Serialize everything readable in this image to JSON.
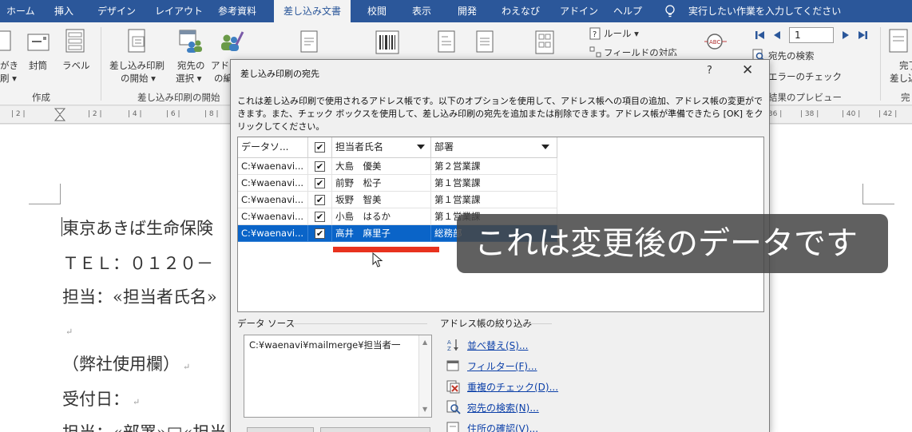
{
  "ribbon_tabs": [
    "ホーム",
    "挿入",
    "デザイン",
    "レイアウト",
    "参考資料",
    "差し込み文書",
    "校閲",
    "表示",
    "開発",
    "わえなび",
    "アドイン",
    "ヘルプ"
  ],
  "active_tab_index": 5,
  "tell_me": "実行したい作業を入力してください",
  "ribbon": {
    "create_group": {
      "hagaki": [
        "がき",
        "刷 ▾"
      ],
      "envelope": "封筒",
      "label": "ラベル",
      "group_label": "作成"
    },
    "start_group": {
      "start_merge": [
        "差し込み印刷",
        "の開始 ▾"
      ],
      "select_recipients": [
        "宛先の",
        "選択 ▾"
      ],
      "edit_list": [
        "アドレ",
        "の編"
      ],
      "group_label": "差し込み印刷の開始"
    },
    "rules": "ルール ▾",
    "match_fields": "フィールドの対応",
    "record_number": "1",
    "find_recipient": "宛先の検索",
    "check_errors": "エラーのチェック",
    "preview_label": "結果のプレビュー",
    "finish": [
      "完了",
      "差し込"
    ],
    "finish_group": "完"
  },
  "ruler_ticks": [
    "| 2 |",
    "| 2 |",
    "| 4 |",
    "| 6 |",
    "| 8 |",
    "| 36 |",
    "| 38 |",
    "| 40 |",
    "| 42 |"
  ],
  "document": {
    "lines": [
      "東京あきば生命保険",
      "ＴＥＬ：０１２０－",
      "担当：«担当者氏名»",
      "",
      "（弊社使用欄）",
      "受付日：",
      "担当：«部署»□«担当"
    ]
  },
  "dialog": {
    "title": "差し込み印刷の宛先",
    "help": "?",
    "close": "✕",
    "description": "これは差し込み印刷で使用されるアドレス帳です。以下のオプションを使用して、アドレス帳への項目の追加、アドレス帳の変更ができます。また、チェック ボックスを使用して、差し込み印刷の宛先を追加または削除できます。アドレス帳が準備できたら [OK] をクリックしてください。",
    "columns": [
      "データソ...",
      "",
      "担当者氏名",
      "部署"
    ],
    "rows": [
      {
        "source": "C:¥waenavi...",
        "checked": "✔",
        "name": "大島　優美",
        "dept": "第２営業課"
      },
      {
        "source": "C:¥waenavi...",
        "checked": "✔",
        "name": "前野　松子",
        "dept": "第１営業課"
      },
      {
        "source": "C:¥waenavi...",
        "checked": "✔",
        "name": "坂野　智美",
        "dept": "第１営業課"
      },
      {
        "source": "C:¥waenavi...",
        "checked": "✔",
        "name": "小島　はるか",
        "dept": "第１営業課"
      },
      {
        "source": "C:¥waenavi...",
        "checked": "✔",
        "name": "高井　麻里子",
        "dept": "総務部"
      }
    ],
    "selected_row_index": 4,
    "data_source_label": "データ ソース",
    "data_source_item": "C:¥waenavi¥mailmerge¥担当者一",
    "refine_label": "アドレス帳の絞り込み",
    "refine_links": [
      "並べ替え(S)...",
      "フィルター(F)...",
      "重複のチェック(D)...",
      "宛先の検索(N)...",
      "住所の確認(V)..."
    ]
  },
  "caption": "これは変更後のデータです",
  "colors": {
    "ribbon_blue": "#2b579a",
    "selection_blue": "#0a64c8",
    "highlight_red": "#e8321e",
    "link_blue": "#0b3fa8"
  }
}
